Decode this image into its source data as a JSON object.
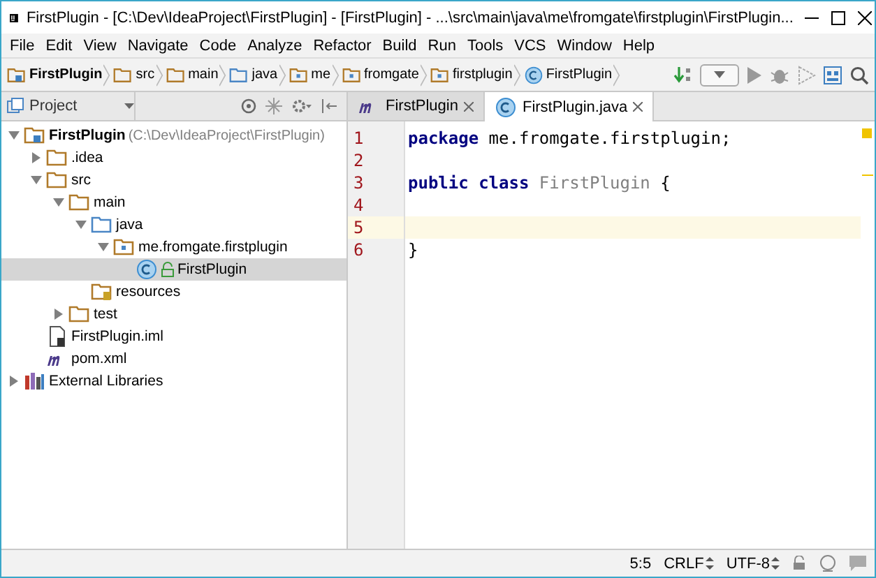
{
  "window": {
    "title": "FirstPlugin - [C:\\Dev\\IdeaProject\\FirstPlugin] - [FirstPlugin] - ...\\src\\main\\java\\me\\fromgate\\firstplugin\\FirstPlugin..."
  },
  "menu": [
    "File",
    "Edit",
    "View",
    "Navigate",
    "Code",
    "Analyze",
    "Refactor",
    "Build",
    "Run",
    "Tools",
    "VCS",
    "Window",
    "Help"
  ],
  "breadcrumbs": [
    {
      "label": "FirstPlugin",
      "kind": "module"
    },
    {
      "label": "src",
      "kind": "folder"
    },
    {
      "label": "main",
      "kind": "folder"
    },
    {
      "label": "java",
      "kind": "source"
    },
    {
      "label": "me",
      "kind": "package"
    },
    {
      "label": "fromgate",
      "kind": "package"
    },
    {
      "label": "firstplugin",
      "kind": "package"
    },
    {
      "label": "FirstPlugin",
      "kind": "class"
    }
  ],
  "project_panel": {
    "view": "Project",
    "tree": [
      {
        "label": "FirstPlugin",
        "path": "(C:\\Dev\\IdeaProject\\FirstPlugin)",
        "kind": "module",
        "expanded": true,
        "selected": false,
        "children": [
          {
            "label": ".idea",
            "kind": "folder",
            "expanded": false,
            "selected": false
          },
          {
            "label": "src",
            "kind": "folder",
            "expanded": true,
            "selected": false,
            "children": [
              {
                "label": "main",
                "kind": "folder",
                "expanded": true,
                "selected": false,
                "children": [
                  {
                    "label": "java",
                    "kind": "source",
                    "expanded": true,
                    "selected": false,
                    "children": [
                      {
                        "label": "me.fromgate.firstplugin",
                        "kind": "package",
                        "expanded": true,
                        "selected": false,
                        "children": [
                          {
                            "label": "FirstPlugin",
                            "kind": "class",
                            "selected": true
                          }
                        ]
                      }
                    ]
                  },
                  {
                    "label": "resources",
                    "kind": "resources",
                    "selected": false
                  }
                ]
              },
              {
                "label": "test",
                "kind": "folder",
                "expanded": false,
                "selected": false
              }
            ]
          },
          {
            "label": "FirstPlugin.iml",
            "kind": "iml",
            "selected": false
          },
          {
            "label": "pom.xml",
            "kind": "maven",
            "selected": false
          }
        ]
      },
      {
        "label": "External Libraries",
        "kind": "libraries",
        "expanded": false,
        "selected": false
      }
    ]
  },
  "editor_tabs": [
    {
      "label": "FirstPlugin",
      "kind": "maven",
      "selected": false
    },
    {
      "label": "FirstPlugin.java",
      "kind": "class",
      "selected": true
    }
  ],
  "code": [
    {
      "number": "1",
      "current": false,
      "tokens": [
        {
          "text": "package",
          "kind": "keyword"
        },
        {
          "text": " me.fromgate.firstplugin;",
          "kind": "plain"
        }
      ]
    },
    {
      "number": "2",
      "current": false
    },
    {
      "number": "3",
      "current": false,
      "tokens": [
        {
          "text": "public class ",
          "kind": "keyword"
        },
        {
          "text": "FirstPlugin",
          "kind": "unused"
        },
        {
          "text": " {",
          "kind": "plain"
        }
      ]
    },
    {
      "number": "4",
      "current": false
    },
    {
      "number": "5",
      "current": true
    },
    {
      "number": "6",
      "current": false,
      "tokens": [
        {
          "text": "}",
          "kind": "plain"
        }
      ]
    }
  ],
  "status_bar": {
    "position": "5:5",
    "line_separator": "CRLF",
    "encoding": "UTF-8"
  }
}
